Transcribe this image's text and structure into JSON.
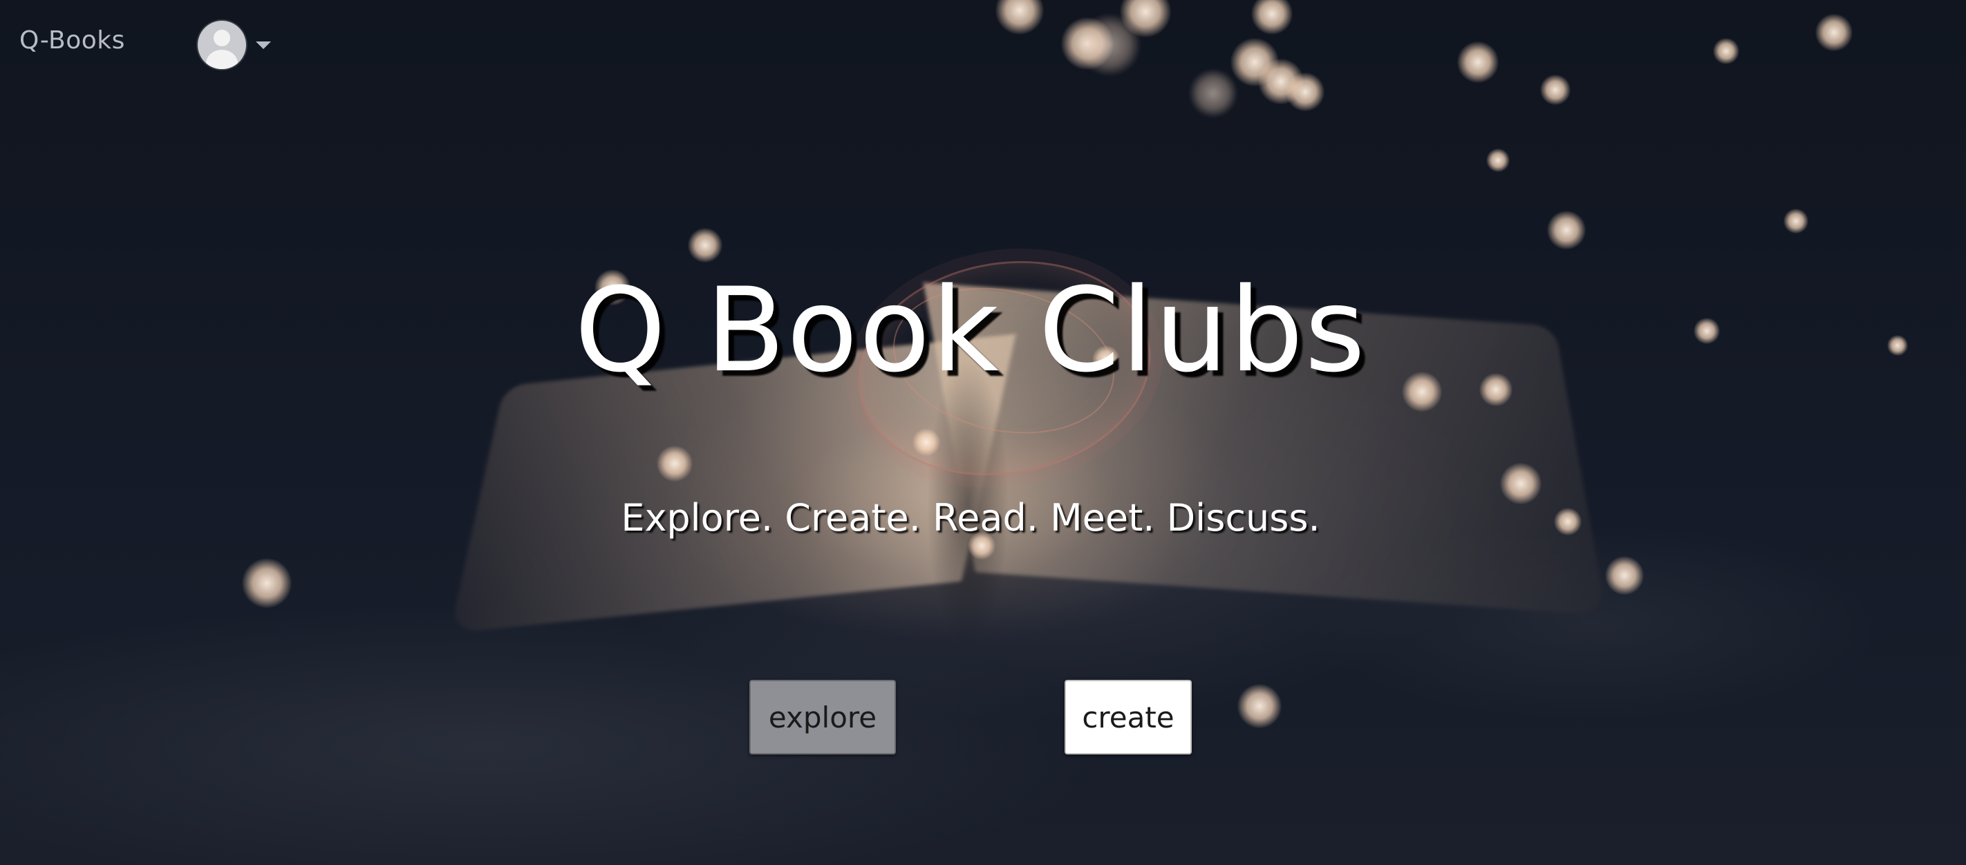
{
  "navbar": {
    "brand": "Q-Books",
    "user_avatar_icon": "user-avatar-icon",
    "menu_caret_icon": "caret-down-icon"
  },
  "hero": {
    "title": "Q Book Clubs",
    "tagline": "Explore. Create. Read. Meet. Discuss.",
    "background_image": "open book with fairy lights",
    "explore_label": "explore",
    "create_label": "create"
  },
  "colors": {
    "background": "#121723",
    "brand_text": "#b7bcc6",
    "title_text": "#ffffff",
    "explore_button": "#8e9096",
    "create_button": "#ffffff"
  }
}
